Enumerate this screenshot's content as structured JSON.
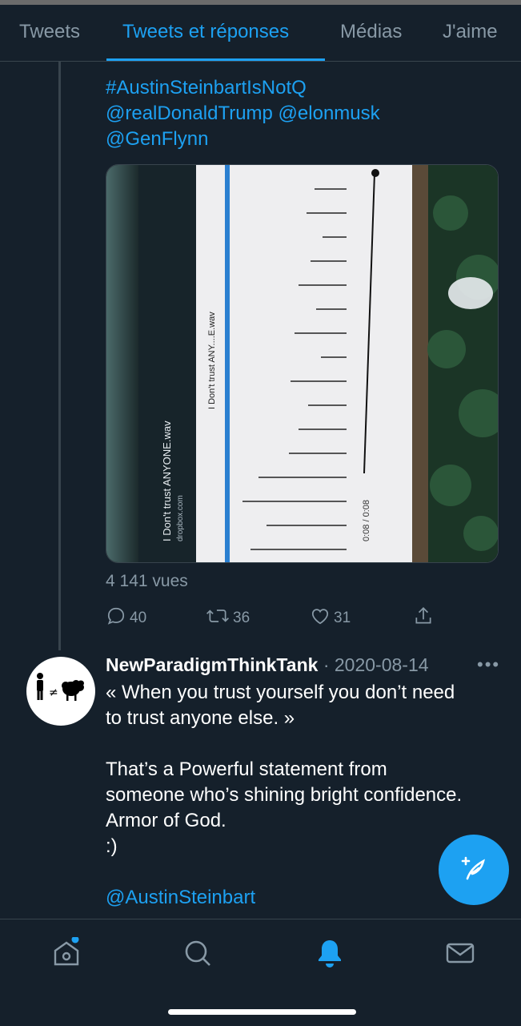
{
  "tabs": [
    {
      "label": "Tweets"
    },
    {
      "label": "Tweets et réponses",
      "active": true
    },
    {
      "label": "Médias"
    },
    {
      "label": "J'aime"
    }
  ],
  "tweet1": {
    "hashtag": "#AustinSteinbartIsNotQ",
    "mentions_line1": "@realDonaldTrump @elonmusk",
    "mentions_line2": "@GenFlynn",
    "media": {
      "file_title": "I Don't trust ANYONE.wav",
      "domain": "dropbox.com",
      "player_title": "I Don't trust ANY....E.wav",
      "time": "0:08 / 0:08"
    },
    "views": "4 141 vues",
    "replies": "40",
    "retweets": "36",
    "likes": "31"
  },
  "tweet2": {
    "author": "NewParadigmThinkTank",
    "separator": "·",
    "date": "2020-08-14",
    "line1": "« When you trust yourself you don’t need",
    "line2": "to trust anyone else. »",
    "line3": "That’s a Powerful statement from",
    "line4": "someone who’s shining bright confidence.",
    "line5": "Armor of God.",
    "line6": ":)",
    "mention": "@AustinSteinbart",
    "more": "•••"
  },
  "icons": {
    "reply": "reply-icon",
    "retweet": "retweet-icon",
    "like": "heart-icon",
    "share": "share-icon",
    "compose": "compose-tweet-icon",
    "home": "home-icon",
    "search": "search-icon",
    "notifications": "bell-icon",
    "messages": "mail-icon"
  },
  "colors": {
    "background": "#15202b",
    "accent": "#1da1f2",
    "muted": "#8899a6"
  }
}
